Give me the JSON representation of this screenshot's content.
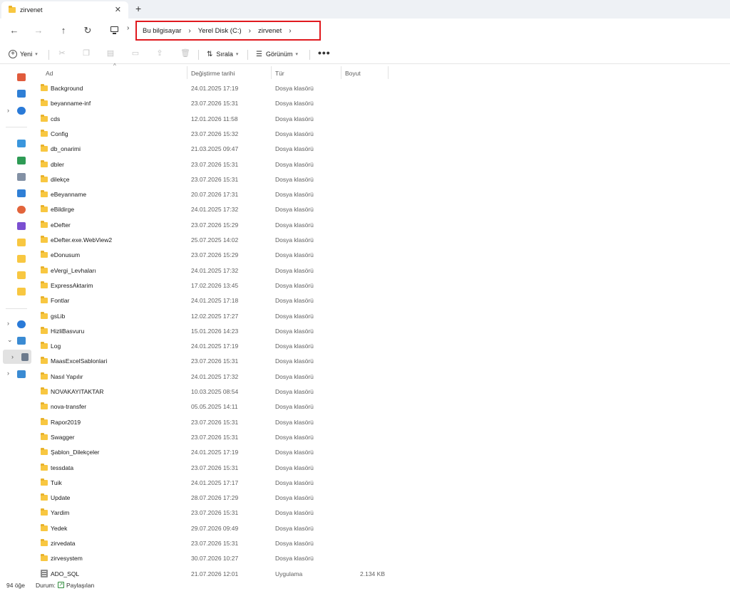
{
  "tab": {
    "title": "zirvenet",
    "close": "✕",
    "new": "+"
  },
  "nav": {
    "back": "←",
    "forward": "→",
    "up": "↑",
    "refresh": "↻"
  },
  "breadcrumb": {
    "items": [
      "Bu bilgisayar",
      "Yerel Disk (C:)",
      "zirvenet"
    ],
    "sep": "›"
  },
  "toolbar": {
    "new_label": "Yeni",
    "sort_label": "Sırala",
    "view_label": "Görünüm",
    "more": "•••"
  },
  "columns": {
    "name": "Ad",
    "date": "Değiştirme tarihi",
    "type": "Tür",
    "size": "Boyut"
  },
  "files": [
    {
      "name": "Background",
      "date": "24.01.2025 17:19",
      "type": "Dosya klasörü",
      "size": "",
      "kind": "folder"
    },
    {
      "name": "beyanname-inf",
      "date": "23.07.2026 15:31",
      "type": "Dosya klasörü",
      "size": "",
      "kind": "folder"
    },
    {
      "name": "cds",
      "date": "12.01.2026 11:58",
      "type": "Dosya klasörü",
      "size": "",
      "kind": "folder"
    },
    {
      "name": "Config",
      "date": "23.07.2026 15:32",
      "type": "Dosya klasörü",
      "size": "",
      "kind": "folder"
    },
    {
      "name": "db_onarimi",
      "date": "21.03.2025 09:47",
      "type": "Dosya klasörü",
      "size": "",
      "kind": "folder"
    },
    {
      "name": "dbler",
      "date": "23.07.2026 15:31",
      "type": "Dosya klasörü",
      "size": "",
      "kind": "folder"
    },
    {
      "name": "dilekçe",
      "date": "23.07.2026 15:31",
      "type": "Dosya klasörü",
      "size": "",
      "kind": "folder"
    },
    {
      "name": "eBeyanname",
      "date": "20.07.2026 17:31",
      "type": "Dosya klasörü",
      "size": "",
      "kind": "folder"
    },
    {
      "name": "eBildirge",
      "date": "24.01.2025 17:32",
      "type": "Dosya klasörü",
      "size": "",
      "kind": "folder"
    },
    {
      "name": "eDefter",
      "date": "23.07.2026 15:29",
      "type": "Dosya klasörü",
      "size": "",
      "kind": "folder"
    },
    {
      "name": "eDefter.exe.WebView2",
      "date": "25.07.2025 14:02",
      "type": "Dosya klasörü",
      "size": "",
      "kind": "folder"
    },
    {
      "name": "eDonusum",
      "date": "23.07.2026 15:29",
      "type": "Dosya klasörü",
      "size": "",
      "kind": "folder"
    },
    {
      "name": "eVergi_Levhaları",
      "date": "24.01.2025 17:32",
      "type": "Dosya klasörü",
      "size": "",
      "kind": "folder"
    },
    {
      "name": "ExpressAktarim",
      "date": "17.02.2026 13:45",
      "type": "Dosya klasörü",
      "size": "",
      "kind": "folder"
    },
    {
      "name": "Fontlar",
      "date": "24.01.2025 17:18",
      "type": "Dosya klasörü",
      "size": "",
      "kind": "folder"
    },
    {
      "name": "gsLib",
      "date": "12.02.2025 17:27",
      "type": "Dosya klasörü",
      "size": "",
      "kind": "folder"
    },
    {
      "name": "HizliBasvuru",
      "date": "15.01.2026 14:23",
      "type": "Dosya klasörü",
      "size": "",
      "kind": "folder"
    },
    {
      "name": "Log",
      "date": "24.01.2025 17:19",
      "type": "Dosya klasörü",
      "size": "",
      "kind": "folder"
    },
    {
      "name": "MaasExcelSablonlari",
      "date": "23.07.2026 15:31",
      "type": "Dosya klasörü",
      "size": "",
      "kind": "folder"
    },
    {
      "name": "Nasıl Yapılır",
      "date": "24.01.2025 17:32",
      "type": "Dosya klasörü",
      "size": "",
      "kind": "folder"
    },
    {
      "name": "NOVAKAYITAKTAR",
      "date": "10.03.2025 08:54",
      "type": "Dosya klasörü",
      "size": "",
      "kind": "folder"
    },
    {
      "name": "nova-transfer",
      "date": "05.05.2025 14:11",
      "type": "Dosya klasörü",
      "size": "",
      "kind": "folder"
    },
    {
      "name": "Rapor2019",
      "date": "23.07.2026 15:31",
      "type": "Dosya klasörü",
      "size": "",
      "kind": "folder"
    },
    {
      "name": "Swagger",
      "date": "23.07.2026 15:31",
      "type": "Dosya klasörü",
      "size": "",
      "kind": "folder"
    },
    {
      "name": "Şablon_Dilekçeler",
      "date": "24.01.2025 17:19",
      "type": "Dosya klasörü",
      "size": "",
      "kind": "folder"
    },
    {
      "name": "tessdata",
      "date": "23.07.2026 15:31",
      "type": "Dosya klasörü",
      "size": "",
      "kind": "folder"
    },
    {
      "name": "Tuik",
      "date": "24.01.2025 17:17",
      "type": "Dosya klasörü",
      "size": "",
      "kind": "folder"
    },
    {
      "name": "Update",
      "date": "28.07.2026 17:29",
      "type": "Dosya klasörü",
      "size": "",
      "kind": "folder"
    },
    {
      "name": "Yardim",
      "date": "23.07.2026 15:31",
      "type": "Dosya klasörü",
      "size": "",
      "kind": "folder"
    },
    {
      "name": "Yedek",
      "date": "29.07.2026 09:49",
      "type": "Dosya klasörü",
      "size": "",
      "kind": "folder"
    },
    {
      "name": "zirvedata",
      "date": "23.07.2026 15:31",
      "type": "Dosya klasörü",
      "size": "",
      "kind": "folder"
    },
    {
      "name": "zirvesystem",
      "date": "30.07.2026 10:27",
      "type": "Dosya klasörü",
      "size": "",
      "kind": "folder"
    },
    {
      "name": "ADO_SQL",
      "date": "21.07.2026 12:01",
      "type": "Uygulama",
      "size": "2.134 KB",
      "kind": "app"
    }
  ],
  "status": {
    "count": "94 öğe",
    "state_label": "Durum:",
    "state_value": "Paylaşılan"
  },
  "colors": {
    "accent_highlight": "#e0191e",
    "folder": "#f8c741",
    "shared": "#2e8b3a"
  }
}
